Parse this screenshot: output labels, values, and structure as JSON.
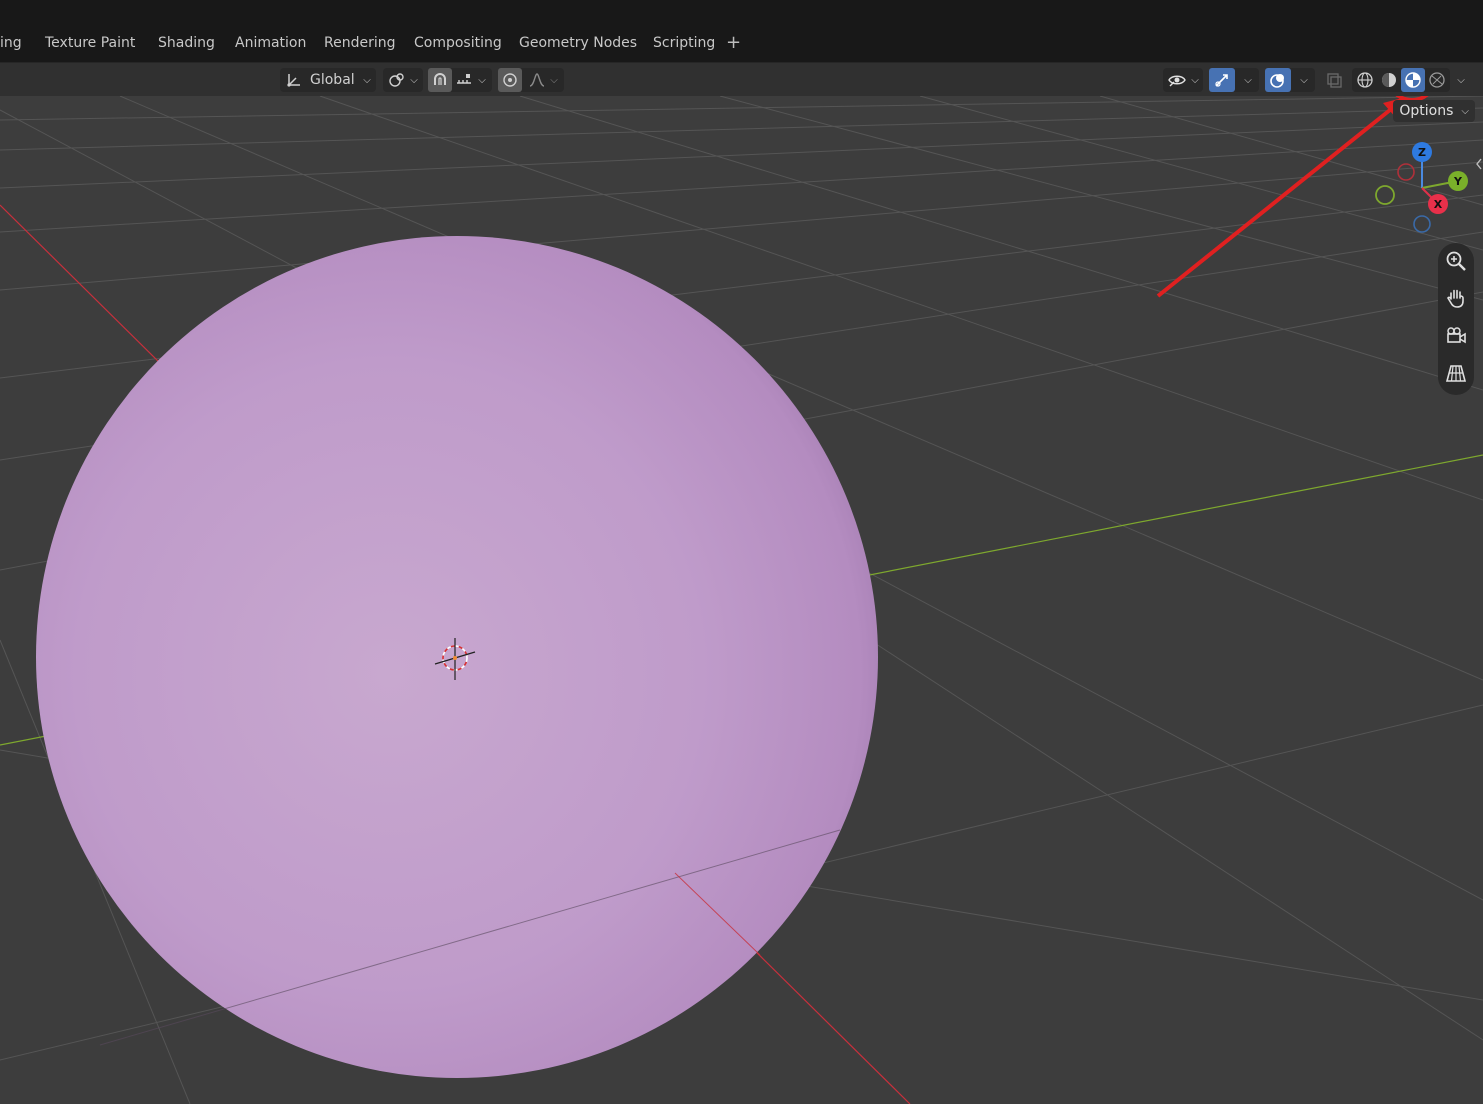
{
  "workspace_tabs": [
    {
      "label": "ing"
    },
    {
      "label": "Texture Paint"
    },
    {
      "label": "Shading"
    },
    {
      "label": "Animation"
    },
    {
      "label": "Rendering"
    },
    {
      "label": "Compositing"
    },
    {
      "label": "Geometry Nodes"
    },
    {
      "label": "Scripting"
    }
  ],
  "add_workspace": "+",
  "header": {
    "transform_orientation": "Global",
    "options_label": "Options",
    "shading_mode_selected": "material-preview"
  },
  "gizmo": {
    "z_label": "Z",
    "y_label": "Y",
    "x_label": "X"
  },
  "colors": {
    "sphere": "#c4a0cc",
    "x_axis_line": "#c8303c",
    "y_axis_line": "#7ea82e",
    "annotation": "#e02020",
    "active_button": "#4772b3"
  },
  "icons": [
    "transform-orientation-icon",
    "pivot-icon",
    "snap-icon",
    "snap-target-icon",
    "proportional-edit-icon",
    "falloff-icon",
    "visibility-icon",
    "gizmo-toggle-icon",
    "overlay-toggle-icon",
    "xray-icon",
    "wireframe-shading-icon",
    "solid-shading-icon",
    "material-preview-shading-icon",
    "rendered-shading-icon",
    "zoom-icon",
    "pan-hand-icon",
    "camera-view-icon",
    "perspective-grid-icon",
    "3d-cursor-icon"
  ]
}
